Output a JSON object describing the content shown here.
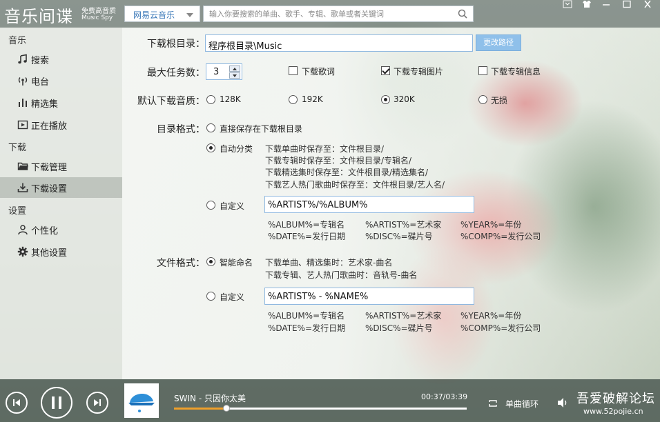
{
  "app": {
    "logo": "音乐间谍",
    "logo_sub1": "免费高音质",
    "logo_sub2": "Music Spy"
  },
  "source": {
    "selected": "网易云音乐"
  },
  "search": {
    "placeholder": "输入你要搜索的单曲、歌手、专辑、歌单或者关键词"
  },
  "sidebar": {
    "sections": [
      {
        "title": "音乐",
        "items": [
          {
            "label": "搜索",
            "icon": "music-note-icon"
          },
          {
            "label": "电台",
            "icon": "radio-icon"
          },
          {
            "label": "精选集",
            "icon": "bars-icon"
          },
          {
            "label": "正在播放",
            "icon": "play-screen-icon"
          }
        ]
      },
      {
        "title": "下载",
        "items": [
          {
            "label": "下载管理",
            "icon": "folder-icon"
          },
          {
            "label": "下载设置",
            "icon": "download-icon",
            "active": true
          }
        ]
      },
      {
        "title": "设置",
        "items": [
          {
            "label": "个性化",
            "icon": "user-icon"
          },
          {
            "label": "其他设置",
            "icon": "gear-icon"
          }
        ]
      }
    ]
  },
  "settings": {
    "root_dir_label": "下载根目录：",
    "root_dir_value": "程序根目录\\Music",
    "change_path_label": "更改路径",
    "max_tasks_label": "最大任务数：",
    "max_tasks_value": "3",
    "checkboxes": [
      {
        "label": "下载歌词",
        "checked": false
      },
      {
        "label": "下载专辑图片",
        "checked": true
      },
      {
        "label": "下载专辑信息",
        "checked": false
      }
    ],
    "quality_label": "默认下载音质：",
    "quality_options": [
      {
        "label": "128K",
        "selected": false
      },
      {
        "label": "192K",
        "selected": false
      },
      {
        "label": "320K",
        "selected": true
      },
      {
        "label": "无损",
        "selected": false
      }
    ],
    "dir_format_label": "目录格式：",
    "dir_opt_direct": "直接保存在下载根目录",
    "dir_opt_auto": "自动分类",
    "dir_auto_lines": [
      "下载单曲时保存至：文件根目录/",
      "下载专辑时保存至：文件根目录/专辑名/",
      "下载精选集时保存至：文件根目录/精选集名/",
      "下载艺人热门歌曲时保存至：文件根目录/艺人名/"
    ],
    "dir_opt_custom": "自定义",
    "dir_custom_value": "%ARTIST%/%ALBUM%",
    "file_format_label": "文件格式：",
    "file_opt_smart": "智能命名",
    "file_smart_lines": [
      "下载单曲、精选集时：艺术家-曲名",
      "下载专辑、艺人热门歌曲时：音轨号-曲名"
    ],
    "file_opt_custom": "自定义",
    "file_custom_value": "%ARTIST% - %NAME%",
    "tag_legend": {
      "row1": [
        "%ALBUM%=专辑名",
        "%ARTIST%=艺术家",
        "%YEAR%=年份"
      ],
      "row2": [
        "%DATE%=发行日期",
        "%DISC%=碟片号",
        "%COMP%=发行公司"
      ]
    },
    "dir_format": "auto",
    "file_format": "smart"
  },
  "player": {
    "song": "SWIN - 只因你太美",
    "time": "00:37/03:39",
    "progress": 0.18,
    "mode": "单曲循环"
  },
  "watermark": {
    "line1": "吾爱破解论坛",
    "line2": "www.52pojie.cn"
  }
}
